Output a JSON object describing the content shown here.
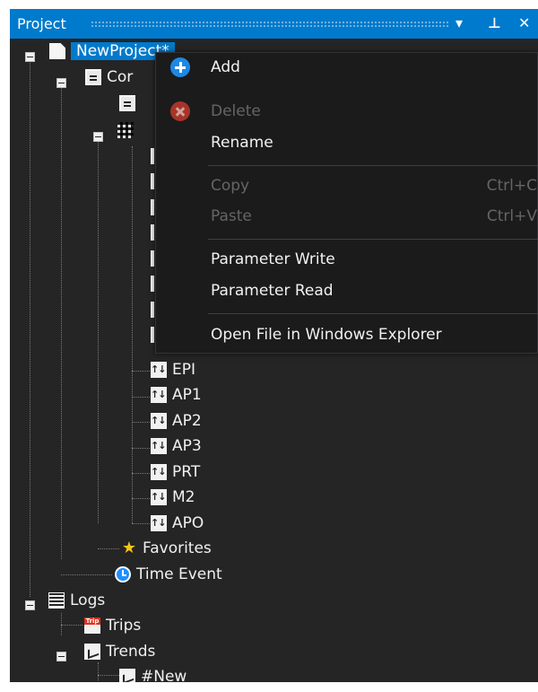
{
  "panel": {
    "title": "Project",
    "dropdown_icon": "▾",
    "pin_icon": "⊥",
    "close_icon": "✕"
  },
  "tree": {
    "root": "NewProject*",
    "controller_label": "Cor",
    "params": [
      "EPI",
      "AP1",
      "AP2",
      "AP3",
      "PRT",
      "M2",
      "APO"
    ],
    "favorites": "Favorites",
    "time_event": "Time Event",
    "logs": "Logs",
    "trips": "Trips",
    "trends": "Trends",
    "trend_new": "#New"
  },
  "context_menu": {
    "add": "Add",
    "delete": "Delete",
    "rename": "Rename",
    "copy": "Copy",
    "copy_shortcut": "Ctrl+C",
    "paste": "Paste",
    "paste_shortcut": "Ctrl+V",
    "parameter_write": "Parameter Write",
    "parameter_read": "Parameter Read",
    "open_explorer": "Open File in Windows Explorer"
  },
  "colors": {
    "accent": "#007acc",
    "panel_bg": "#252526",
    "menu_bg": "#1b1b1c",
    "disabled_text": "#656565"
  }
}
